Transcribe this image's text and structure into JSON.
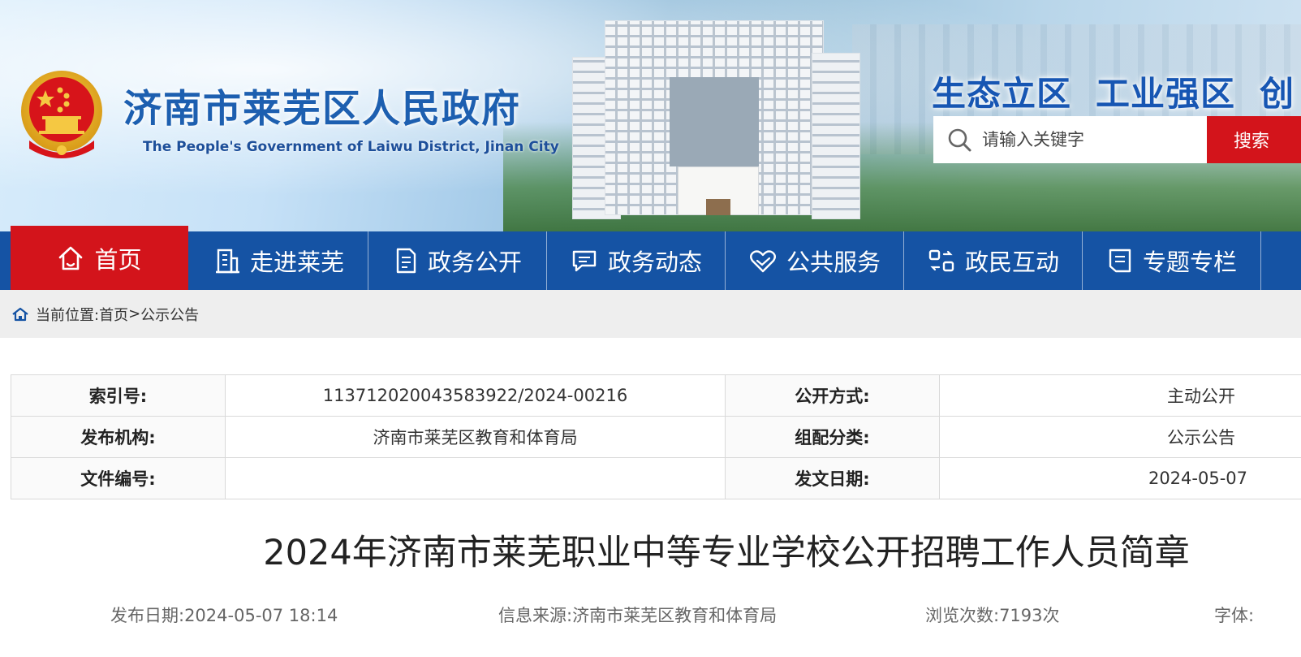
{
  "header": {
    "site_title": "济南市莱芜区人民政府",
    "site_subtitle": "The People's Government of Laiwu District, Jinan City",
    "slogans": [
      "生态立区",
      "工业强区",
      "创"
    ],
    "search_placeholder": "请输入关键字",
    "search_button": "搜索",
    "colors": {
      "title_blue": "#1d5fb0",
      "nav_blue": "#1553a4",
      "accent_red": "#d3141b"
    }
  },
  "nav": {
    "items": [
      {
        "label": "首页",
        "icon": "home-icon"
      },
      {
        "label": "走进莱芜",
        "icon": "building-icon"
      },
      {
        "label": "政务公开",
        "icon": "document-icon"
      },
      {
        "label": "政务动态",
        "icon": "chat-icon"
      },
      {
        "label": "公共服务",
        "icon": "heart-hands-icon"
      },
      {
        "label": "政民互动",
        "icon": "interaction-icon"
      },
      {
        "label": "专题专栏",
        "icon": "list-icon"
      }
    ]
  },
  "breadcrumb": {
    "prefix": "当前位置:",
    "home": "首页",
    "separator": ">",
    "current": "公示公告"
  },
  "meta": {
    "index_label": "索引号:",
    "index_value": "113712020043583922/2024-00216",
    "open_method_label": "公开方式:",
    "open_method_value": "主动公开",
    "publisher_label": "发布机构:",
    "publisher_value": "济南市莱芜区教育和体育局",
    "category_label": "组配分类:",
    "category_value": "公示公告",
    "doc_no_label": "文件编号:",
    "doc_no_value": "",
    "issue_date_label": "发文日期:",
    "issue_date_value": "2024-05-07"
  },
  "article": {
    "title": "2024年济南市莱芜职业中等专业学校公开招聘工作人员简章",
    "publish_date": "发布日期:2024-05-07 18:14",
    "source": "信息来源:济南市莱芜区教育和体育局",
    "views": "浏览次数:7193次",
    "font_size_label": "字体:"
  }
}
